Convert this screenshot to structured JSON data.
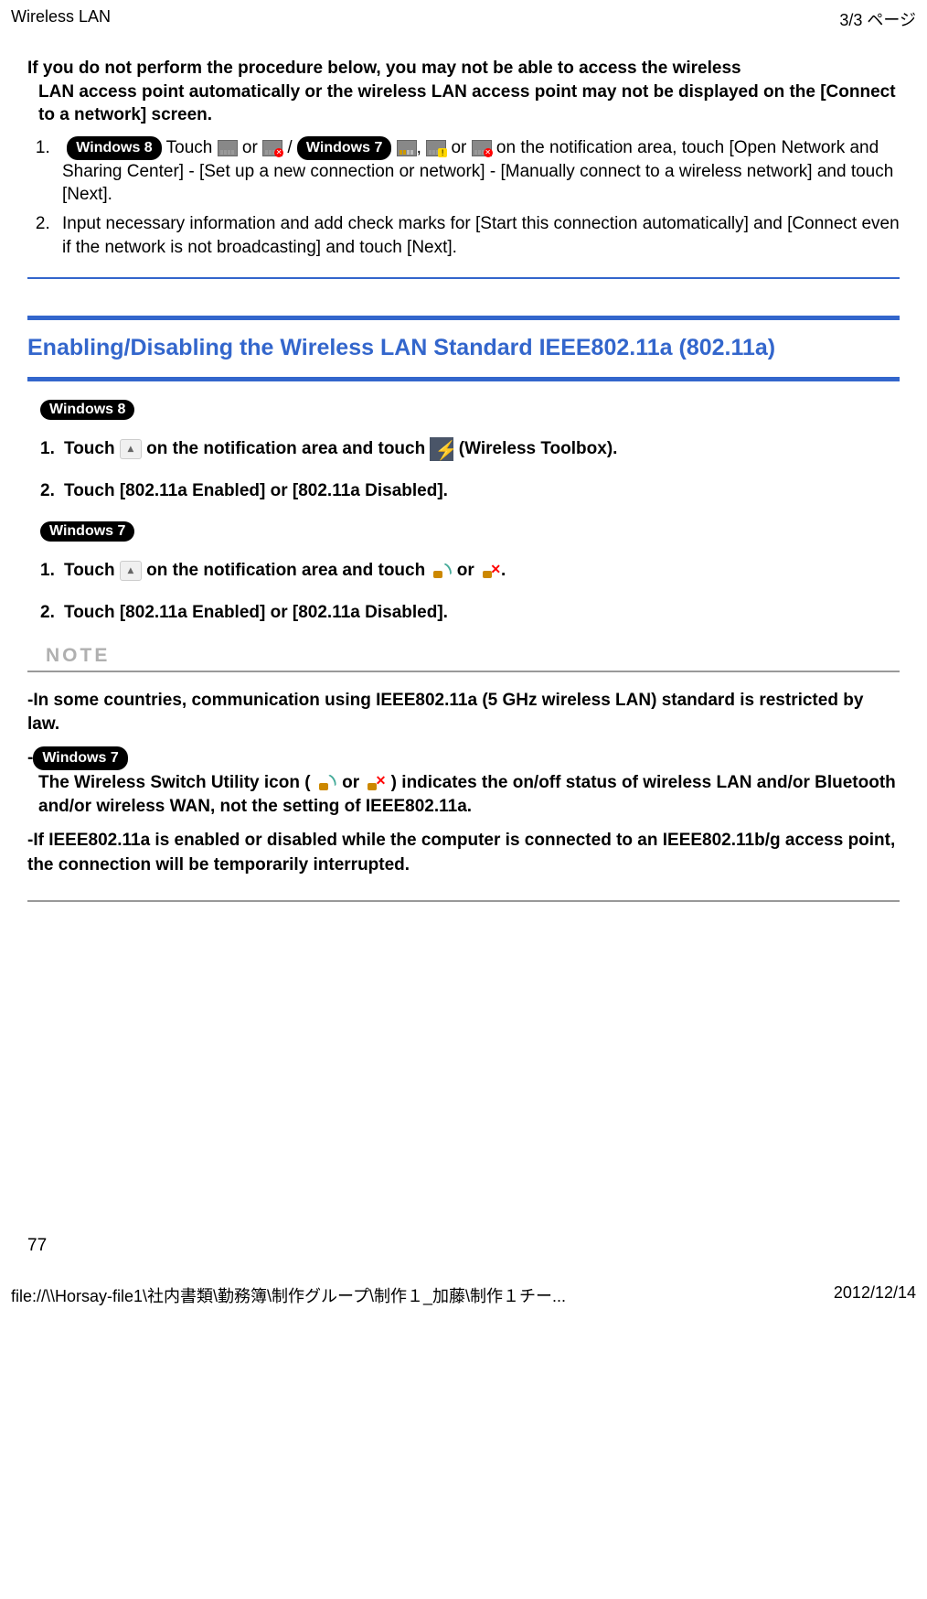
{
  "header": {
    "title": "Wireless LAN",
    "page_indicator": "3/3 ページ"
  },
  "intro": {
    "line1": "If you do not perform the procedure below, you may not be able to access the wireless",
    "line2": "LAN access point automatically or the wireless LAN access point may not be displayed on the [Connect to a network] screen."
  },
  "steps_intro": {
    "step1": {
      "win8": "Windows 8",
      "touch_word": " Touch ",
      "or1": " or ",
      "slash": " / ",
      "win7": "Windows 7",
      "space": "  ",
      "comma": ", ",
      "or2": " or ",
      "on_the": " on the",
      "rest": "notification area, touch [Open Network and Sharing Center] - [Set up a new connection or network] - [Manually connect to a wireless network] and touch [Next]."
    },
    "step2": "Input necessary information and add check marks for [Start this connection automatically] and [Connect even if the network is not broadcasting] and touch [Next]."
  },
  "section": {
    "title": "Enabling/Disabling the Wireless LAN Standard IEEE802.11a (802.11a)"
  },
  "win8_block": {
    "badge": "Windows 8",
    "step1_a": "Touch ",
    "step1_b": " on the notification area and touch ",
    "step1_c": " (Wireless Toolbox).",
    "step2": "Touch [802.11a Enabled] or [802.11a Disabled]."
  },
  "win7_block": {
    "badge": "Windows 7",
    "step1_a": "Touch ",
    "step1_b": " on the notification area and touch ",
    "step1_c": " or ",
    "step1_d": ".",
    "step2": "Touch [802.11a Enabled] or [802.11a Disabled]."
  },
  "note": {
    "label": "NOTE",
    "item1": "In some countries, communication using IEEE802.11a (5 GHz wireless LAN) standard is restricted by law.",
    "item2_badge": "Windows 7",
    "item2_a": "The Wireless Switch Utility icon ( ",
    "item2_b": " or ",
    "item2_c": " ) indicates the on/off status of wireless LAN and/or Bluetooth and/or wireless WAN, not the setting of IEEE802.11a.",
    "item3": "If IEEE802.11a is enabled or disabled while the computer is connected to an IEEE802.11b/g access point, the connection will be temporarily interrupted."
  },
  "page_number": "77",
  "footer": {
    "path": "file://\\\\Horsay-file1\\社内書類\\勤務簿\\制作グループ\\制作１_加藤\\制作１チー...",
    "date": "2012/12/14"
  }
}
